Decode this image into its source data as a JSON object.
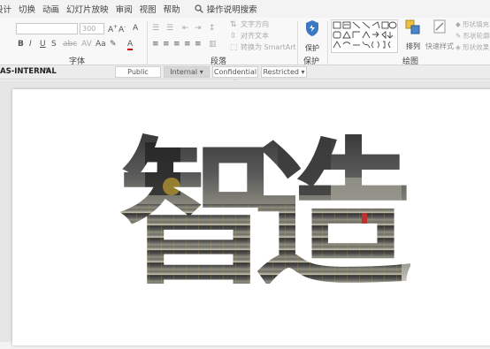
{
  "menu": {
    "items": [
      "设计",
      "切换",
      "动画",
      "幻灯片放映",
      "审阅",
      "视图",
      "帮助"
    ],
    "search_label": "操作说明搜索"
  },
  "ribbon": {
    "font_group_label": "字体",
    "font_size": "300",
    "paragraph_group_label": "段落",
    "text_direction_label": "文字方向",
    "align_text_label": "对齐文本",
    "smartart_label": "转换为 SmartArt",
    "protect_label": "保护",
    "protect_group_label": "保护",
    "arrange_label": "排列",
    "quick_styles_label": "快速样式",
    "drawing_group_label": "绘图",
    "shape_fill_label": "形状填充",
    "shape_outline_label": "形状轮廓",
    "shape_effects_label": "形状效果"
  },
  "classification": {
    "label": "AS-INTERNAL",
    "options": [
      "Public",
      "Internal",
      "Confidential",
      "Restricted"
    ],
    "active": "Internal"
  },
  "slide": {
    "characters": [
      "智",
      "造"
    ]
  },
  "colors": {
    "protect_icon": "#3a78c3",
    "ribbon_bg": "#f8f8f8",
    "slide_bg": "#ffffff"
  }
}
